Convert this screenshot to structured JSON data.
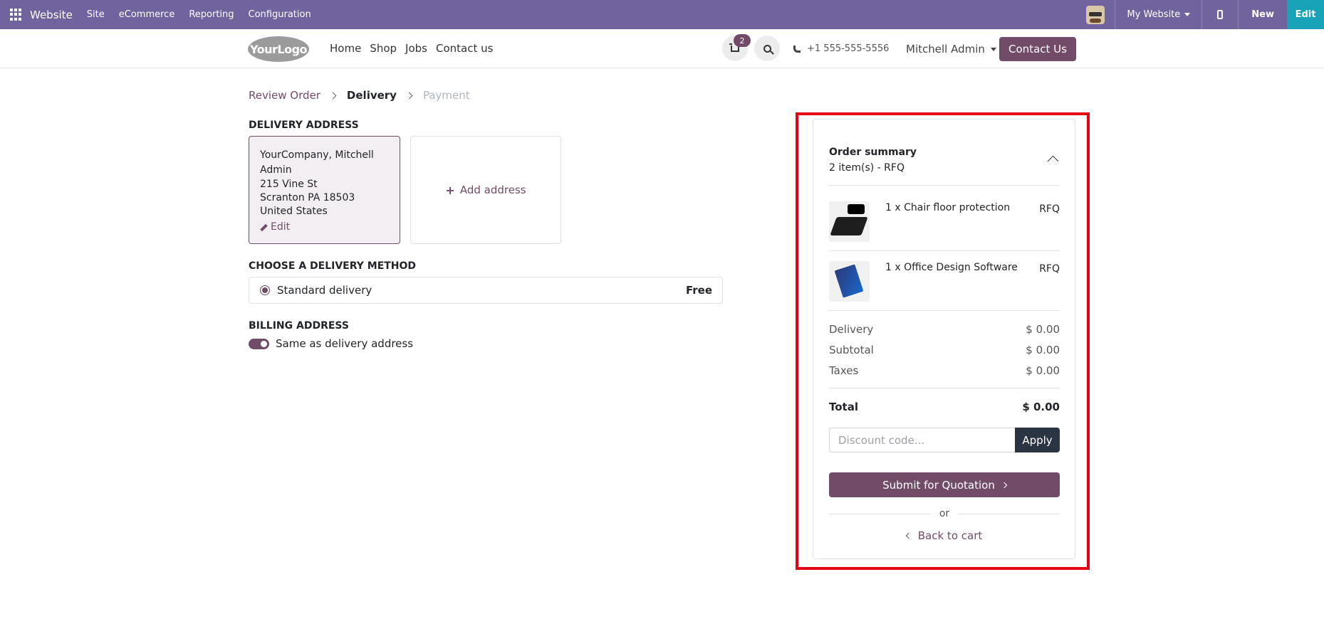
{
  "adminbar": {
    "brand": "Website",
    "menu": [
      "Site",
      "eCommerce",
      "Reporting",
      "Configuration"
    ],
    "website_switcher": "My Website",
    "new_label": "New",
    "edit_label": "Edit"
  },
  "header": {
    "logo_text": "YourLogo",
    "nav": [
      "Home",
      "Shop",
      "Jobs",
      "Contact us"
    ],
    "cart_count": "2",
    "phone": "+1 555-555-5556",
    "user": "Mitchell Admin",
    "contact_button": "Contact Us"
  },
  "breadcrumb": {
    "steps": [
      "Review Order",
      "Delivery",
      "Payment"
    ]
  },
  "delivery_address": {
    "title": "DELIVERY ADDRESS",
    "name": "YourCompany, Mitchell Admin",
    "street": "215 Vine St",
    "city": "Scranton PA 18503",
    "country": "United States",
    "edit_label": "Edit",
    "add_label": "Add address"
  },
  "delivery_method": {
    "title": "CHOOSE A DELIVERY METHOD",
    "option_label": "Standard delivery",
    "option_price": "Free"
  },
  "billing": {
    "title": "BILLING ADDRESS",
    "same_label": "Same as delivery address",
    "same_enabled": true
  },
  "summary": {
    "title": "Order summary",
    "subtitle": "2 item(s) -  RFQ",
    "items": [
      {
        "name": "1 x Chair floor protection",
        "price": "RFQ",
        "thumb": "chair-floor-mat"
      },
      {
        "name": "1 x Office Design Software",
        "price": "RFQ",
        "thumb": "software-box"
      }
    ],
    "delivery_label": "Delivery",
    "delivery_value": "$ 0.00",
    "subtotal_label": "Subtotal",
    "subtotal_value": "$ 0.00",
    "taxes_label": "Taxes",
    "taxes_value": "$ 0.00",
    "total_label": "Total",
    "total_value": "$ 0.00",
    "discount_placeholder": "Discount code...",
    "apply_label": "Apply",
    "submit_label": "Submit for Quotation",
    "or_label": "or",
    "back_label": "Back to cart"
  },
  "colors": {
    "adminbar": "#71639e",
    "brand_primary": "#714b67",
    "edit_button": "#17a2b8",
    "highlight": "#e80015"
  }
}
